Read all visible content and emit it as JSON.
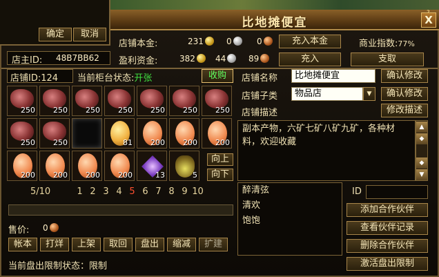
{
  "dialog": {
    "confirm": "确定",
    "cancel": "取消"
  },
  "window": {
    "title": "比地摊便宜",
    "close": "X",
    "help": "?"
  },
  "header": {
    "owner_id_label": "店主ID:",
    "owner_id": "48B7BB62",
    "capital_label": "店铺本金:",
    "capital_gold": "231",
    "capital_silver": "0",
    "capital_copper": "0",
    "topup_capital": "充入本金",
    "commerce_label": "商业指数:",
    "commerce_value": "77%",
    "profit_label": "盈利资金:",
    "profit_gold": "382",
    "profit_silver": "44",
    "profit_copper": "89",
    "topup": "充入",
    "withdraw": "支取"
  },
  "shop": {
    "shop_id": "店铺ID:124",
    "counter_status_label": "当前柜台状态:",
    "counter_status": "开张",
    "buy_button": "收购",
    "name_label": "店铺名称",
    "name_value": "比地摊便宜",
    "confirm_edit": "确认修改",
    "type_label": "店铺子类",
    "type_value": "物品店",
    "desc_label": "店铺描述",
    "edit_desc": "修改描述",
    "description": "副本产物，六矿七矿八矿九矿，各种材料，欢迎收藏"
  },
  "inventory": {
    "slots": [
      {
        "type": "ore",
        "count": "250"
      },
      {
        "type": "ore",
        "count": "250"
      },
      {
        "type": "ore",
        "count": "250"
      },
      {
        "type": "ore",
        "count": "250"
      },
      {
        "type": "ore",
        "count": "250"
      },
      {
        "type": "ore",
        "count": "250"
      },
      {
        "type": "ore",
        "count": "250"
      },
      {
        "type": "ore",
        "count": "250"
      },
      {
        "type": "ore",
        "count": "250"
      },
      {
        "type": "empty",
        "count": ""
      },
      {
        "type": "egg-yellow",
        "count": "81"
      },
      {
        "type": "egg",
        "count": "200"
      },
      {
        "type": "egg",
        "count": "200"
      },
      {
        "type": "egg",
        "count": "200"
      },
      {
        "type": "egg",
        "count": "200"
      },
      {
        "type": "egg",
        "count": "200"
      },
      {
        "type": "egg",
        "count": "200"
      },
      {
        "type": "egg",
        "count": "200"
      },
      {
        "type": "gem",
        "count": "13"
      },
      {
        "type": "flask",
        "count": "5"
      }
    ],
    "page_indicator": "5/10",
    "pages": [
      "1",
      "2",
      "3",
      "4",
      "5",
      "6",
      "7",
      "8",
      "9",
      "10"
    ],
    "current_page": "5",
    "up": "向上",
    "down": "向下"
  },
  "partners": {
    "list": [
      "醉清弦",
      "清欢",
      "饱饱"
    ],
    "id_label": "ID",
    "add": "添加合作伙伴",
    "view": "查看伙伴记录",
    "delete": "删除合作伙伴",
    "activate": "激活盘出限制"
  },
  "footer": {
    "price_label": "售价:",
    "price_value": "0",
    "actions": [
      "帐本",
      "打烊",
      "上架",
      "取回",
      "盘出",
      "缩减",
      "扩建"
    ],
    "limit_status": "当前盘出限制状态：限制"
  }
}
